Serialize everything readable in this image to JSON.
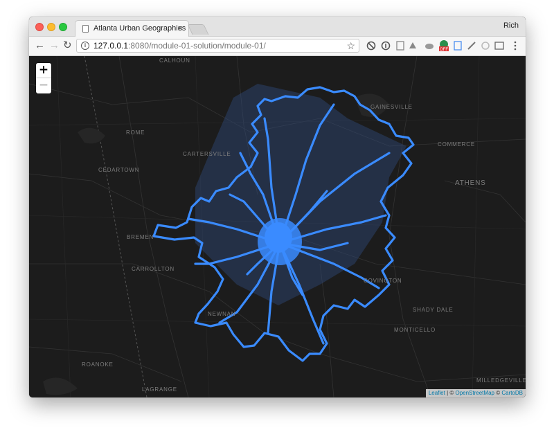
{
  "window": {
    "tab_title": "Atlanta Urban Geographies",
    "tab_close": "×",
    "profile_name": "Rich"
  },
  "toolbar": {
    "back": "←",
    "forward": "→",
    "reload": "↻",
    "url_host": "127.0.0.1",
    "url_path": ":8080/module-01-solution/module-01/",
    "star": "☆",
    "extensions": [
      "sync-icon",
      "info-icon",
      "doc-icon",
      "drive-icon",
      "cloud-icon",
      "adblock-off-icon",
      "privacy-icon",
      "pen-icon",
      "link-icon",
      "cast-icon",
      "menu-icon"
    ]
  },
  "map": {
    "zoom_in": "+",
    "zoom_out": "−",
    "labels": {
      "calhoun": "CALHOUN",
      "gainesville": "GAINESVILLE",
      "rome": "ROME",
      "cartersville": "CARTERSVILLE",
      "commerce": "COMMERCE",
      "cedartown": "CEDARTOWN",
      "athens": "ATHENS",
      "bremen": "BREMEN",
      "carrollton": "CARROLLTON",
      "covington": "COVINGTON",
      "shady_dale": "SHADY DALE",
      "newnan": "NEWNAN",
      "monticello": "MONTICELLO",
      "roanoke": "ROANOKE",
      "lagrange": "LAGRANGE",
      "milledgeville": "MILLEDGEVILLE"
    },
    "colors": {
      "background": "#1c1c1c",
      "network": "#3a8bff",
      "fill": "#2f4a7a",
      "roads": "#3a3a3a"
    },
    "attribution": {
      "leaflet": "Leaflet",
      "sep": " | © ",
      "osm": "OpenStreetMap",
      "mid": " © ",
      "carto": "CartoDB"
    }
  }
}
